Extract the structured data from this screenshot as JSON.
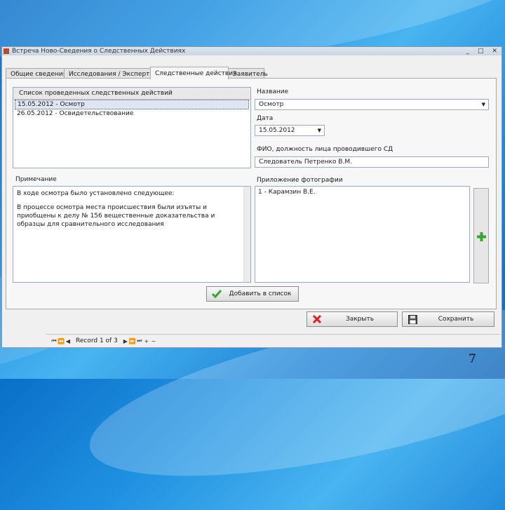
{
  "window": {
    "title": "Встреча Ново-Сведения о Следственных Действиях",
    "buttons": [
      "_",
      "□",
      "✕"
    ]
  },
  "tabs": [
    {
      "label": "Общие сведения"
    },
    {
      "label": "Исследования / Экспертизы"
    },
    {
      "label": "Следственные действия"
    },
    {
      "label": "Заявитель"
    }
  ],
  "actions_list": {
    "header": "Список проведенных следственных действий",
    "items": [
      "15.05.2012 - Осмотр",
      "26.05.2012 - Освидетельствование"
    ]
  },
  "form": {
    "name_label": "Название",
    "name_value": "Осмотр",
    "date_label": "Дата",
    "date_value": "15.05.2012",
    "officer_label": "ФИО, должность лица проводившего СД",
    "officer_value": "Следователь Петренко В.М.",
    "note_label": "Примечание",
    "note_paragraphs": [
      "В ходе осмотра было установлено следующее:",
      "В процессе осмотра места происшествия были изъяты и приобщены к делу № 156 вещественные доказательства и образцы для сравнительного исследования"
    ],
    "photos_label": "Приложение фотографии",
    "photos_items": [
      "1 - Карамзин В.Е."
    ]
  },
  "buttons": {
    "add_to_list": "Добавить в список",
    "close": "Закрыть",
    "save": "Сохранить"
  },
  "navigator": {
    "record_text": "Record 1 of 3"
  },
  "slide": {
    "page_number": "7"
  },
  "colors": {
    "accent_green": "#3aa335",
    "close_red": "#d9261c",
    "selection": "#dde6f2"
  }
}
